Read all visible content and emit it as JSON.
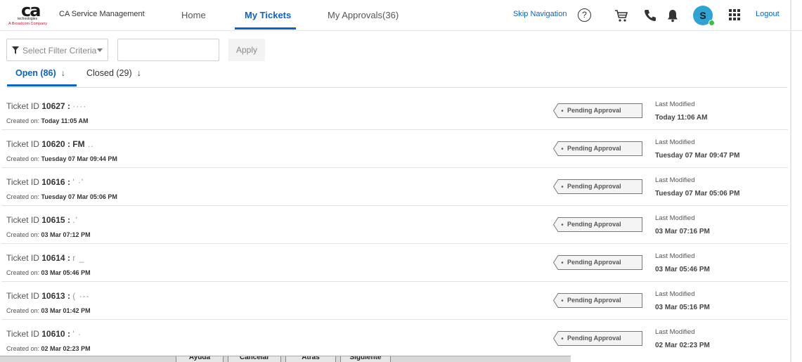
{
  "header": {
    "logo_ca": "ca",
    "logo_technologies": "technologies",
    "logo_broadcom": "A Broadcom Company",
    "app_name": "CA Service Management",
    "nav": {
      "home": "Home",
      "my_tickets": "My Tickets",
      "my_approvals": "My Approvals(36)"
    },
    "skip_navigation": "Skip Navigation",
    "help": "?",
    "avatar_initial": "S",
    "logout": "Logout",
    "accent_color": "#0a63c9",
    "avatar_color": "#2ea3d6",
    "status_color": "#3cc13b"
  },
  "filters": {
    "select_placeholder": "Select Filter Criteria",
    "search_value": "",
    "apply_label": "Apply"
  },
  "tabs": {
    "open": "Open (86)",
    "closed": "Closed (29)",
    "sort_arrow": "↓"
  },
  "tickets": [
    {
      "prefix": "Ticket ID ",
      "id": "10627 : ",
      "subject": "····",
      "created_label": "Created on: ",
      "created": "Today 11:05 AM",
      "status": "Pending Approval",
      "modified_label": "Last Modified",
      "modified": "Today 11:06 AM"
    },
    {
      "prefix": "Ticket ID ",
      "id": "10620 : FM",
      "subject": " ..",
      "created_label": "Created on: ",
      "created": "Tuesday 07 Mar 09:44 PM",
      "status": "Pending Approval",
      "modified_label": "Last Modified",
      "modified": "Tuesday 07 Mar 09:47 PM"
    },
    {
      "prefix": "Ticket ID ",
      "id": "10616 : ",
      "subject": "'  ·'",
      "created_label": "Created on: ",
      "created": "Tuesday 07 Mar 05:06 PM",
      "status": "Pending Approval",
      "modified_label": "Last Modified",
      "modified": "Tuesday 07 Mar 05:06 PM"
    },
    {
      "prefix": "Ticket ID ",
      "id": "10615 : ",
      "subject": ".'",
      "created_label": "Created on: ",
      "created": "03 Mar 07:12 PM",
      "status": "Pending Approval",
      "modified_label": "Last Modified",
      "modified": "03 Mar 07:16 PM"
    },
    {
      "prefix": "Ticket ID ",
      "id": "10614 : ",
      "subject": "r  _",
      "created_label": "Created on: ",
      "created": "03 Mar 05:46 PM",
      "status": "Pending Approval",
      "modified_label": "Last Modified",
      "modified": "03 Mar 05:46 PM"
    },
    {
      "prefix": "Ticket ID ",
      "id": "10613 : ",
      "subject": "(  ·--",
      "created_label": "Created on: ",
      "created": "03 Mar 01:42 PM",
      "status": "Pending Approval",
      "modified_label": "Last Modified",
      "modified": "03 Mar 05:16 PM"
    },
    {
      "prefix": "Ticket ID ",
      "id": "10610 : ",
      "subject": "'  ·",
      "created_label": "Created on: ",
      "created": "02 Mar 02:23 PM",
      "status": "Pending Approval",
      "modified_label": "Last Modified",
      "modified": "02 Mar 02:23 PM"
    }
  ],
  "bottom_bar": {
    "buttons": [
      "Ayuda",
      "Cancelar",
      "Atrás",
      "Siguiente"
    ]
  }
}
